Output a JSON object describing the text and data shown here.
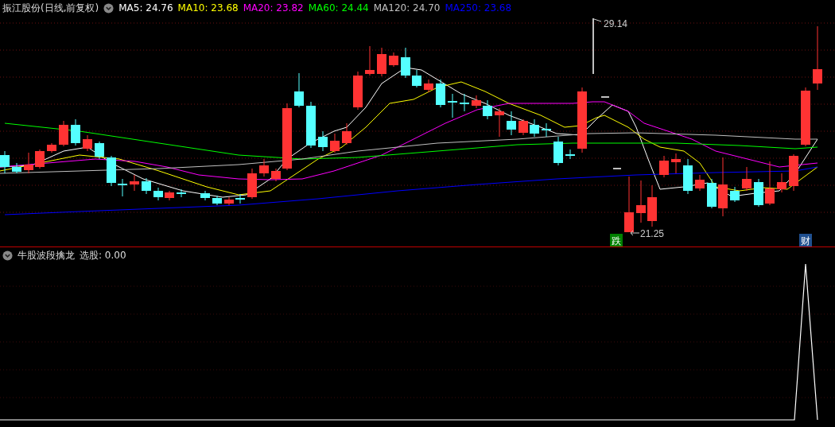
{
  "price_panel": {
    "title": "振江股份(日线,前复权)",
    "indicators": [
      {
        "label": "MA5: 24.76",
        "color": "#ffffff"
      },
      {
        "label": "MA10: 23.68",
        "color": "#ffff00"
      },
      {
        "label": "MA20: 23.82",
        "color": "#ff00ff"
      },
      {
        "label": "MA60: 24.44",
        "color": "#00ff00"
      },
      {
        "label": "MA120: 24.70",
        "color": "#c0c0c0"
      },
      {
        "label": "MA250: 23.68",
        "color": "#0000ff"
      }
    ],
    "high_label": "29.14",
    "low_label": "21.25",
    "markers": [
      {
        "text": "跌",
        "color": "#008000"
      },
      {
        "text": "财",
        "color": "#1f4f8f"
      }
    ]
  },
  "indicator_panel": {
    "title": "牛股波段擒龙",
    "reading": "选股: 0.00"
  }
}
